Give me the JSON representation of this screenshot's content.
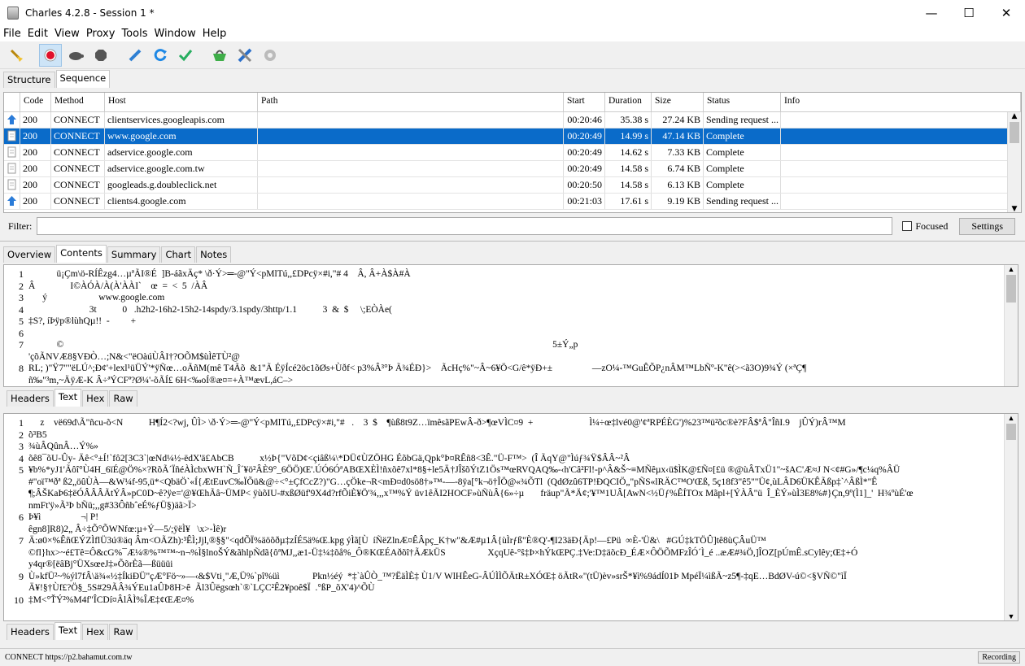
{
  "window": {
    "title": "Charles 4.2.8 - Session 1 *"
  },
  "menu": [
    "File",
    "Edit",
    "View",
    "Proxy",
    "Tools",
    "Window",
    "Help"
  ],
  "top_tabs": [
    "Structure",
    "Sequence"
  ],
  "columns": [
    "Code",
    "Method",
    "Host",
    "Path",
    "Start",
    "Duration",
    "Size",
    "Status",
    "Info"
  ],
  "rows": [
    {
      "icon": "upload-arrow-icon",
      "code": "200",
      "method": "CONNECT",
      "host": "clientservices.googleapis.com",
      "path": "",
      "start": "00:20:46",
      "duration": "35.38 s",
      "size": "27.24 KB",
      "status": "Sending request ...",
      "info": ""
    },
    {
      "icon": "document-icon",
      "code": "200",
      "method": "CONNECT",
      "host": "www.google.com",
      "path": "",
      "start": "00:20:49",
      "duration": "14.99 s",
      "size": "47.14 KB",
      "status": "Complete",
      "info": "",
      "selected": true
    },
    {
      "icon": "document-icon",
      "code": "200",
      "method": "CONNECT",
      "host": "adservice.google.com",
      "path": "",
      "start": "00:20:49",
      "duration": "14.62 s",
      "size": "7.33 KB",
      "status": "Complete",
      "info": ""
    },
    {
      "icon": "document-icon",
      "code": "200",
      "method": "CONNECT",
      "host": "adservice.google.com.tw",
      "path": "",
      "start": "00:20:49",
      "duration": "14.58 s",
      "size": "6.74 KB",
      "status": "Complete",
      "info": ""
    },
    {
      "icon": "document-icon",
      "code": "200",
      "method": "CONNECT",
      "host": "googleads.g.doubleclick.net",
      "path": "",
      "start": "00:20:50",
      "duration": "14.58 s",
      "size": "6.13 KB",
      "status": "Complete",
      "info": ""
    },
    {
      "icon": "upload-arrow-icon",
      "code": "200",
      "method": "CONNECT",
      "host": "clients4.google.com",
      "path": "",
      "start": "00:21:03",
      "duration": "17.61 s",
      "size": "9.19 KB",
      "status": "Sending request ...",
      "info": ""
    }
  ],
  "filter": {
    "label": "Filter:",
    "value": "",
    "focused_label": "Focused",
    "settings_label": "Settings"
  },
  "detail_tabs": [
    "Overview",
    "Contents",
    "Summary",
    "Chart",
    "Notes"
  ],
  "req_tabs": [
    "Headers",
    "Text",
    "Hex",
    "Raw"
  ],
  "resp_tabs": [
    "Headers",
    "Text",
    "Hex",
    "Raw"
  ],
  "req_lines": [
    {
      "n": "1",
      "t": "            ü¡Çm\\ö-RÍÊzg4…µªÃI®É  ]B-áãxÄç* \\ð·Ý>═-@\"Ý<pMlTú,,£DPcÿ×#i,\"# 4    Â, Â+À$À#À"
    },
    {
      "n": "2",
      "t": "Â               I©ÀÓÀ/À(À'ÀÀI`    œ  =  <  5  /ÀÂ"
    },
    {
      "n": "3",
      "t": "      ý                      www.google.com"
    },
    {
      "n": "4",
      "t": "                          3t           0   .h2h2-16h2-15h2-14spdy/3.1spdy/3http/1.1           3  &  $     \\;EÒÀe("
    },
    {
      "n": "5",
      "t": "‡S?, íÞÿp®lùhQµ!!  -         +"
    },
    {
      "n": "6",
      "t": ""
    },
    {
      "n": "7",
      "t": "            ©                                                                                                                                                                                                                 5±Ý„p"
    },
    {
      "n": "",
      "t": "'çõÃNVÆ8§VÐÒ…;N&<\"ëOàúÙÂI†?OÕM$ùÌêTÙ²@"
    },
    {
      "n": "8",
      "t": "RL; )\"Ÿ7\"\"ëLÚ^;Ð¢'+lexl¹üÜÝ'*ÿÑœ…oÃñM(mê T4Ãõ  &1\"Ã ÉÿÍcé2öc1õØs+Ùðf< p3%Â³°Þ Ã¾ÉÐ}>    ÃcHç%\"~Â~6¥Ö<G/ê*ÿÐ+±                 —zO¼-™GuÊÕP¿nÂM™LbÑº-K\"ê(><ã3O)9¾Ý (×ªÇ¶"
    },
    {
      "n": "",
      "t": "ñ‰\"³m,~ÄÿÆ-K Â÷ªÝCFª?Ø¼'-õÃÍ£ 6H<‰oÍ®æ¤=+À™ævL,áC–>"
    }
  ],
  "resp_lines": [
    {
      "n": "1",
      "t": "     z    vë69d\\Ã\"ñcu-õ<N           H¶Í2<?wj, ÛÌ> \\ð·Ý>═-@\"Ý<pMlTú,,£DPcÿ×#i,\"#   .    3  $    ¶ùß8t9Z…ïmêsãPEwÂ-ð>¶œVÌC¤9  +                        Ì¼÷œ‡lvé0@'¢ªRPÉÈG')%23™ü²õc®è?FÂ$ªÂ\"ÎñI.9    jÛÝ)rÂ™M"
    },
    {
      "n": "2",
      "t": "õ³B5"
    },
    {
      "n": "3",
      "t": "¾ùÂQûnÂ…Ý%»"
    },
    {
      "n": "4",
      "t": "õê8¯õU-Ûy- Äê<°±Í!`fô2[3C3`|œNd¼½-ëdX'ä£AbCB           x½Þ{\"VõD¢<çiâß¼\\*DÜ¢ÙZÖHG ÉõbGä,Qpk°Þ¤RÊñ8<3Ê.\"Ü-F™>  (Î ÃqY@\"Ìúƒ¾Ÿ$ÂÂ~²Â"
    },
    {
      "n": "5",
      "t": "¥b%*yJ1'Ãôî°Ù4H_6ïÉ@Ö%×?RõÃ´ÏñéÀÌcbxWH`Ñ_Î´¥ö²ÂÈ9°_6ÖÖ)Œ'.ÚÓ6ÓªABŒXÈÌ!ñxõê7xl*8§+le5Ä†JÎšõÝtZ1Ös™œRVQAQ‰-‹h'Câ²Fl!-p^Â&Š~≡MÑêµx‹ü$ÌK@£Ñ¤[£ü ®@ùÂTxÜ1\"~šAC'Æ≈J N<¢#G»/¶c¼q%ÂÜ"
    },
    {
      "n": "",
      "t": "#\"oï™ðª ß2„öûÙÀ—&W¼f-95,ü*<QbäÖ`«Í{ÆtEuvC‰ÏÕü&@÷<°±ÇfCcZ?)\"G…çÖke¬R<mÐ¤d0sö8†»™-—-8ÿa[°k¬ö†ÎÖ@«¾ÕTl  (QdØzû6TP!ÐQCIÖ„\"pÑS«lRÄC™O'Œß, 5ç18f3\"ê5\"\"Ü¢,ùLÂD6ÜKÊÃßp‡`^ÂßÌ*\"Ê"
    },
    {
      "n": "",
      "t": "¶;ÂŠKaÞ6‡ëÓÂÂÂÃtÝÂ»pC0D~ê?ÿe='@¥ŒhÃâ~ÜMP< ÿùõIU-#xßØüf'9X4d?rfÕiÈ¥Ö'¾,,,x™%Ý üv1êÃI2HOCF»ùÑùÂ{6»÷µ       fräup\"Ã*Ä¢;'¥™1UÂ[AwN<½Üƒ%ÊÍTOx Mãpl+[ÝÀÂ\"ü  Î_ÈÝ»ùÌ3E8%#}Çn,9º(Ì1]_'  H¾ºùÉ'œ"
    },
    {
      "n": "",
      "t": "nmFt'ÿ»Ã³Þ bÑü;,,g#33ÔñbˆeÉ%ƒÜ§)äã>Ï>"
    },
    {
      "n": "6",
      "t": "Þ¥ì                 ¬| P!"
    },
    {
      "n": "",
      "t": "êgn8]R8)2„ Â÷‡Õ°ÕWNfœ:µ+Ý—5/;ÿëÌ¥   \\x>-Ìê)r"
    },
    {
      "n": "7",
      "t": "Ä:ø0×%ÊñŒÝZÌflÜ3ú®äq Âm<OÃZh):³ÊÌ;Jjl,®§§\"<qdÕÏ%äöõðµ‡zÍÉ5ä%Œ.kpg ýÌã[Ù  íÑëZlnÆ¤ÊÂpç_K†w\"&Æ#µ1Â{ùÌrƒß\"È®Q'-¶I23äÐ{Äp!—£Pü  ∞È-'Ü&\\   #GÚ‡kTÖÛ]tê8ùÇÂuÜ™"
    },
    {
      "n": "",
      "t": "©fl}hx>~é£Tê=Ô&cG%¯Æ¼®%™™~n¬%Ì§lnoŠÝ&ãhlpÑdã{ôªMJ,,æ1-Ü‡¼‡õå%_Ô®KŒÉAðõî†ÃÆkÜS                  XçqUê-°ŝ‡Þ×hÝkŒPÇ.‡Ve:D‡äõcÐ_ÉÆ×ÔÖÕMFzÎÓ´Ì_é ..æÆ#¾Ö,]ÎOZ[pÚmÊ.sCylêy;Œ‡+Ó"
    },
    {
      "n": "",
      "t": "y4qr®[ëâBj°ÜXsœeJ‡»ÕõrÈã—ßüüüi"
    },
    {
      "n": "9",
      "t": "Ù»kfÜ²~%ýl7fÂ\\ä¾«½‡ÍkiÐÜ\"çÆ°Fö~»—‹&$Vti¸\"Æ,Ü%`pî%üì              Pkn½éý  *‡`àÛÒ_™?ËäÌÈ‡ Ù1/V WlHÊeG-ÂÚÌÌÕÄtR±XÓŒ‡ öÃtR«\"(tÜ)èv»srŠ*¥ì%9ádÍ01Þ MpéÏ¼ìßÃ~z5¶-‡qE…BdØV-ú©<§VÑ©\"ìÏ"
    },
    {
      "n": "",
      "t": "Ä¥!§†Ùf£?Ö§_5S#29ÃÂ¾ÝEu1aÛÞ8H>ê  Ãl3Ûëgsœh`®`LÇC²Ê2¥poê$Ï  .°ßP_õX'4)^ÕÙ"
    },
    {
      "n": "10",
      "t": "‡M<°ŤÝ²%M4f\"ÎCDí¤ÂlÂÌ%ÎÆ‡¢ŒÆ¤%"
    }
  ],
  "status_bar": {
    "text": "CONNECT https://p2.bahamut.com.tw",
    "recording": "Recording"
  }
}
